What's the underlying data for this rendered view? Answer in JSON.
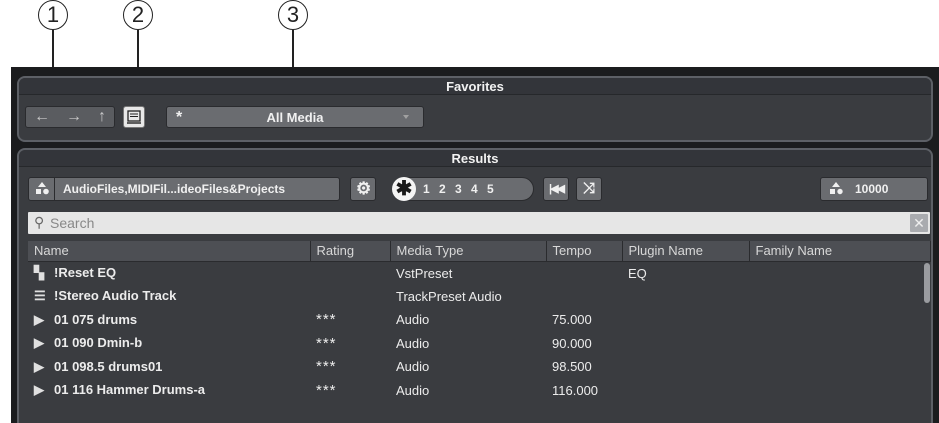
{
  "callouts": [
    "1",
    "2",
    "3"
  ],
  "favorites": {
    "title": "Favorites",
    "nav": [
      "←",
      "→",
      "↑"
    ],
    "media_star": "*",
    "media_label": "All Media"
  },
  "results": {
    "title": "Results",
    "media_filter_label": "AudioFiles,MIDIFil...ideoFiles&Projects",
    "rating_nums": "1 2 3 4 5",
    "count": "10000",
    "search_placeholder": "Search",
    "columns": [
      "Name",
      "Rating",
      "Media Type",
      "Tempo",
      "Plugin Name",
      "Family Name"
    ],
    "rows": [
      {
        "icon": "vstpreset-icon",
        "name": "!Reset EQ",
        "rating": "",
        "media_type": "VstPreset",
        "tempo": "",
        "plugin": "EQ",
        "family": ""
      },
      {
        "icon": "trackpreset-icon",
        "name": "!Stereo Audio Track",
        "rating": "",
        "media_type": "TrackPreset Audio",
        "tempo": "",
        "plugin": "",
        "family": ""
      },
      {
        "icon": "audio-play-icon",
        "name": "01 075 drums",
        "rating": "***",
        "media_type": "Audio",
        "tempo": "75.000",
        "plugin": "",
        "family": ""
      },
      {
        "icon": "audio-play-icon",
        "name": "01 090 Dmin-b",
        "rating": "***",
        "media_type": "Audio",
        "tempo": "90.000",
        "plugin": "",
        "family": ""
      },
      {
        "icon": "audio-play-icon",
        "name": "01 098.5 drums01",
        "rating": "***",
        "media_type": "Audio",
        "tempo": "98.500",
        "plugin": "",
        "family": ""
      },
      {
        "icon": "audio-play-icon",
        "name": "01 116 Hammer Drums-a",
        "rating": "***",
        "media_type": "Audio",
        "tempo": "116.000",
        "plugin": "",
        "family": ""
      }
    ]
  }
}
